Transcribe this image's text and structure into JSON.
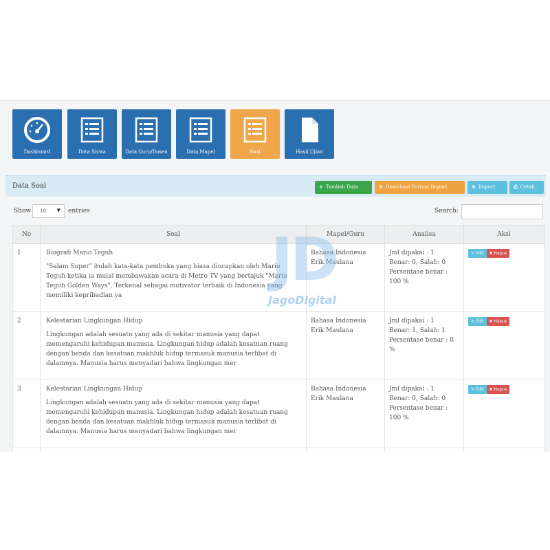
{
  "nav": {
    "tiles": [
      {
        "label": "Dashboard",
        "icon": "dashboard-gauge-icon"
      },
      {
        "label": "Data Siswa",
        "icon": "list-icon"
      },
      {
        "label": "Data Guru/Dosen",
        "icon": "list-icon"
      },
      {
        "label": "Data Mapel",
        "icon": "list-icon"
      },
      {
        "label": "Soal",
        "icon": "list-icon",
        "active": true
      },
      {
        "label": "Hasil Ujian",
        "icon": "document-icon"
      }
    ]
  },
  "panel": {
    "title": "Data Soal",
    "buttons": {
      "tambah": "Tambah Data",
      "download": "Download Format Import",
      "import": "Import",
      "cetak": "Cetak"
    }
  },
  "table_controls": {
    "show_label": "Show",
    "page_size": "10",
    "entries_label": "entries",
    "search_label": "Search:"
  },
  "table": {
    "headers": {
      "no": "No",
      "soal": "Soal",
      "mapel": "Mapel/Guru",
      "analisa": "Analisa",
      "aksi": "Aksi"
    },
    "rows": [
      {
        "no": "1",
        "title": "Biografi Mario Teguh",
        "body": "\"Salam Super\" itulah kata-kata pembuka yang biasa diucapkan oleh Mario Teguh ketika ia mulai membawakan acara di Metro TV yang bertajuk \"Mario Teguh Golden Ways\". Terkenal sebagai motivator terbaik di Indonesia yang memiliki kepribadian ya",
        "mapel": "Bahasa Indonesia",
        "guru": "Erik Maulana",
        "jml": "Jml dipakai : 1",
        "benar_salah": "Benar: 0, Salah: 0",
        "persentase": "Persentase benar : 100 %"
      },
      {
        "no": "2",
        "title": "Kelestarian Lingkungan Hidup",
        "body": "Lingkungan adalah sesuatu yang ada di sekitar manusia yang dapat memengaruhi kehidupan manusia. Lingkungan hidup adalah kesatuan ruang dengan benda dan kesatuan makhluk hidup termasuk manusia terlibat di dalamnya. Manusia harus menyadari bahwa lingkungan mer",
        "mapel": "Bahasa Indonesia",
        "guru": "Erik Maulana",
        "jml": "Jml dipakai : 1",
        "benar_salah": "Benar: 1, Salah: 1",
        "persentase": "Persentase benar : 0 %"
      },
      {
        "no": "3",
        "title": "Kelestarian Lingkungan Hidup",
        "body": "Lingkungan adalah sesuatu yang ada di sekitar manusia yang dapat memengaruhi kehidupan manusia. Lingkungan hidup adalah kesatuan ruang dengan benda dan kesatuan makhluk hidup termasuk manusia terlibat di dalamnya. Manusia harus menyadari bahwa lingkungan mer",
        "mapel": "Bahasa Indonesia",
        "guru": "Erik Maulana",
        "jml": "Jml dipakai : 1",
        "benar_salah": "Benar: 0, Salah: 0",
        "persentase": "Persentase benar : 100 %"
      }
    ],
    "edit_label": "Edit",
    "hapus_label": "Hapus"
  },
  "watermark": {
    "logo": "JD",
    "text": "JagoDigital"
  },
  "colors": {
    "primary": "#2a6fb0",
    "active": "#f0a64a",
    "green": "#3aa54a",
    "cyan": "#5dc0de",
    "red": "#d9534f"
  }
}
